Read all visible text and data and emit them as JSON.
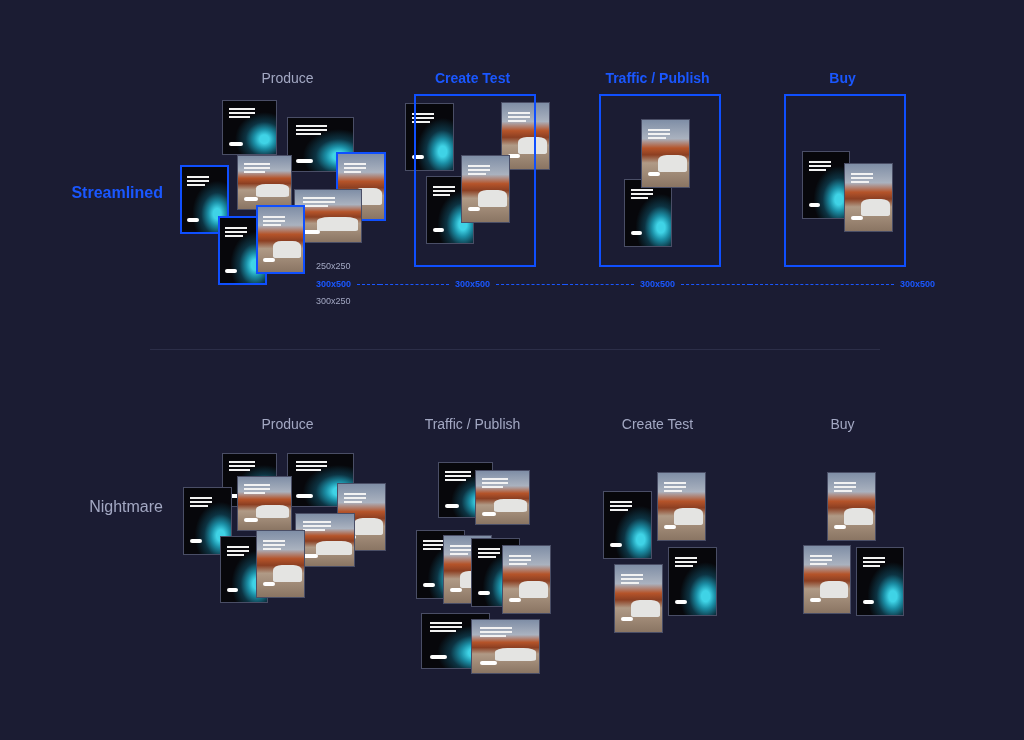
{
  "rows": [
    {
      "label": "Streamlined",
      "highlighted": true,
      "stages": [
        {
          "title": "Produce",
          "highlighted": false,
          "framed": false,
          "size_labels": [
            {
              "text": "250x250",
              "selected": false
            },
            {
              "text": "300x500",
              "selected": true
            },
            {
              "text": "300x250",
              "selected": false
            }
          ],
          "ads": [
            {
              "kind": "dark",
              "selected": false
            },
            {
              "kind": "dark",
              "selected": false
            },
            {
              "kind": "dark",
              "selected": true
            },
            {
              "kind": "photo",
              "selected": false
            },
            {
              "kind": "photo",
              "selected": true
            },
            {
              "kind": "photo",
              "selected": false
            },
            {
              "kind": "dark",
              "selected": true
            },
            {
              "kind": "photo",
              "selected": true
            }
          ]
        },
        {
          "title": "Create Test",
          "highlighted": true,
          "framed": true,
          "size_label": "300x500",
          "ads": [
            {
              "kind": "dark",
              "selected": false
            },
            {
              "kind": "photo",
              "selected": false
            },
            {
              "kind": "dark",
              "selected": false
            },
            {
              "kind": "photo",
              "selected": false
            }
          ]
        },
        {
          "title": "Traffic / Publish",
          "highlighted": true,
          "framed": true,
          "size_label": "300x500",
          "ads": [
            {
              "kind": "dark",
              "selected": false
            },
            {
              "kind": "photo",
              "selected": false
            }
          ]
        },
        {
          "title": "Buy",
          "highlighted": true,
          "framed": true,
          "size_label": "300x500",
          "ads": [
            {
              "kind": "dark",
              "selected": false
            },
            {
              "kind": "photo",
              "selected": false
            }
          ]
        }
      ]
    },
    {
      "label": "Nightmare",
      "highlighted": false,
      "stages": [
        {
          "title": "Produce",
          "highlighted": false,
          "framed": false,
          "ads": [
            {
              "kind": "dark",
              "selected": false
            },
            {
              "kind": "dark",
              "selected": false
            },
            {
              "kind": "dark",
              "selected": false
            },
            {
              "kind": "photo",
              "selected": false
            },
            {
              "kind": "photo",
              "selected": false
            },
            {
              "kind": "photo",
              "selected": false
            },
            {
              "kind": "dark",
              "selected": false
            },
            {
              "kind": "photo",
              "selected": false
            }
          ]
        },
        {
          "title": "Traffic / Publish",
          "highlighted": false,
          "framed": false,
          "ads": [
            {
              "kind": "dark",
              "selected": false
            },
            {
              "kind": "photo",
              "selected": false
            },
            {
              "kind": "dark",
              "selected": false
            },
            {
              "kind": "photo",
              "selected": false
            },
            {
              "kind": "dark",
              "selected": false
            },
            {
              "kind": "photo",
              "selected": false
            },
            {
              "kind": "dark",
              "selected": false
            },
            {
              "kind": "photo",
              "selected": false
            }
          ]
        },
        {
          "title": "Create Test",
          "highlighted": false,
          "framed": false,
          "ads": [
            {
              "kind": "photo",
              "selected": false
            },
            {
              "kind": "dark",
              "selected": false
            },
            {
              "kind": "photo",
              "selected": false
            },
            {
              "kind": "dark",
              "selected": false
            }
          ]
        },
        {
          "title": "Buy",
          "highlighted": false,
          "framed": false,
          "ads": [
            {
              "kind": "photo",
              "selected": false
            },
            {
              "kind": "photo",
              "selected": false
            },
            {
              "kind": "dark",
              "selected": false
            }
          ]
        }
      ]
    }
  ]
}
